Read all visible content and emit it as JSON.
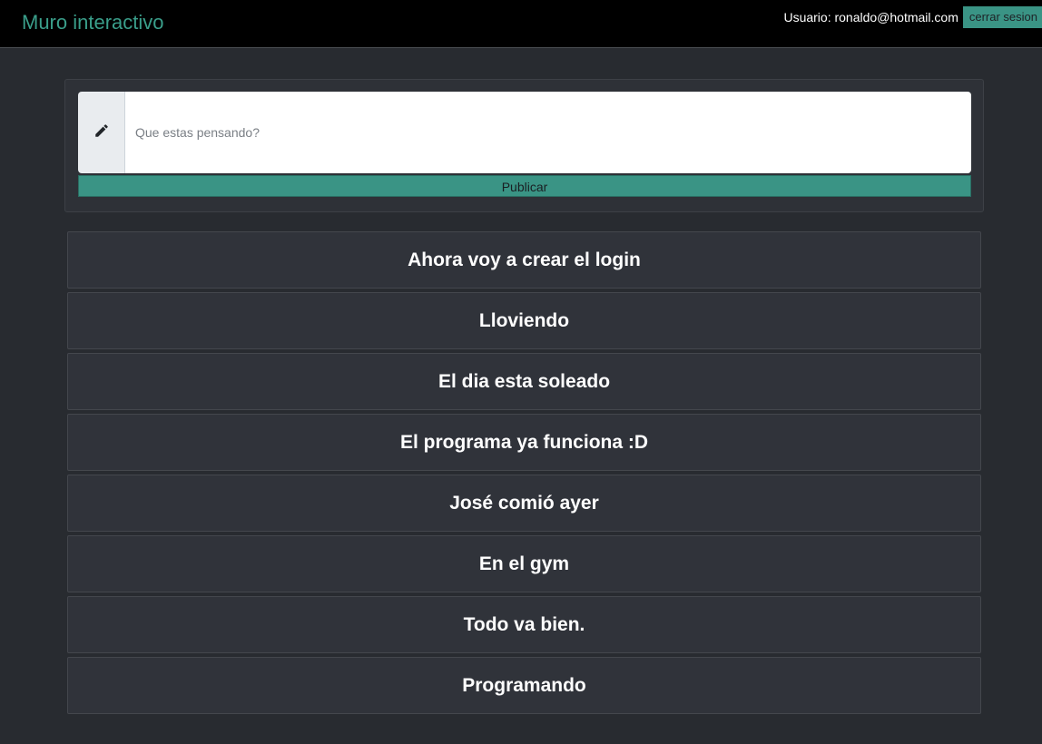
{
  "header": {
    "brand": "Muro interactivo",
    "user_label": "Usuario: ronaldo@hotmail.com",
    "logout_label": "cerrar sesion"
  },
  "composer": {
    "placeholder": "Que estas pensando?",
    "value": "",
    "icon": "pencil-icon",
    "publish_label": "Publicar"
  },
  "posts": [
    "Ahora voy a crear el login",
    "Lloviendo",
    "El dia esta soleado",
    "El programa ya funciona :D",
    "José comió ayer",
    "En el gym",
    "Todo va bien.",
    "Programando"
  ],
  "colors": {
    "accent": "#3a9485",
    "brand_text": "#3a9e8a",
    "background": "#282b30",
    "topbar": "#000000",
    "card": "#30333a"
  }
}
